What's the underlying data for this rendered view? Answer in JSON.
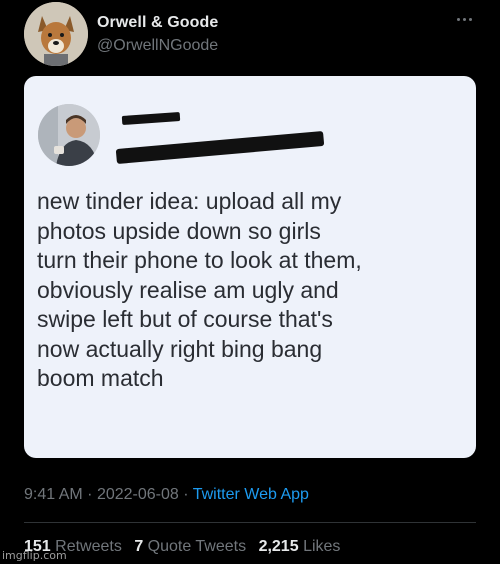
{
  "tweet": {
    "display_name": "Orwell & Goode",
    "handle": "@OrwellNGoode",
    "more_icon": "more-horizontal-icon",
    "image_text_lines": [
      "new tinder idea: upload all my",
      "photos upside down so girls",
      "turn their phone to look at them,",
      "obviously realise am ugly and",
      "swipe left but of course that's",
      "now actually right bing bang",
      "boom match"
    ],
    "time": "9:41 AM",
    "date": "2022-06-08",
    "separator": "·",
    "source": "Twitter Web App",
    "stats": {
      "retweets_count": "151",
      "retweets_label": "Retweets",
      "quote_count": "7",
      "quote_label": "Quote Tweets",
      "likes_count": "2,215",
      "likes_label": "Likes"
    }
  },
  "watermark": "imgflip.com",
  "colors": {
    "background": "#000000",
    "link": "#1d9bf0",
    "secondary_text": "#71767b",
    "card_background": "#eef2fa"
  }
}
